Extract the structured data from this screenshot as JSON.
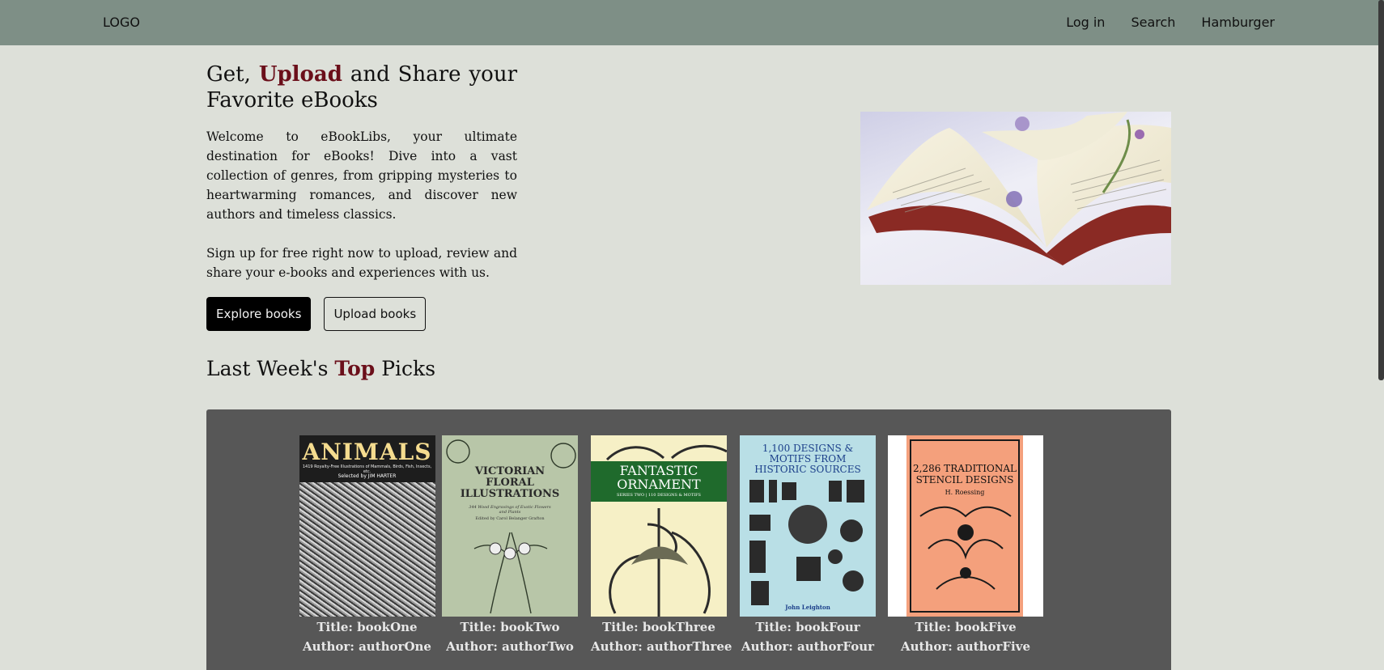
{
  "nav": {
    "logo": "LOGO",
    "links": [
      "Log in",
      "Search",
      "Hamburger"
    ]
  },
  "hero": {
    "title_prefix": "Get,",
    "title_accent": "Upload",
    "title_suffix": "and Share your Favorite eBooks",
    "paragraph1": "Welcome to eBookLibs, your ultimate destination for eBooks! Dive into a vast collection of genres, from gripping mysteries to heartwarming romances, and discover new authors and timeless classics.",
    "paragraph2": "Sign up for free right now to upload, review and share your e-books and experiences with us.",
    "explore_label": "Explore books",
    "upload_label": "Upload books"
  },
  "picks": {
    "title_prefix": "Last Week's",
    "title_accent": "Top",
    "title_suffix": "Picks",
    "books": [
      {
        "title": "Title: bookOne",
        "author": "Author: authorOne",
        "cover_text": "ANIMALS",
        "cover_sub": "1419 Royalty-Free Illustrations of Mammals, Birds, Fish, Insects, etc.",
        "cover_credit": "Selected by JIM HARTER",
        "cover_color": "#222222"
      },
      {
        "title": "Title: bookTwo",
        "author": "Author: authorTwo",
        "cover_text": "VICTORIAN FLORAL ILLUSTRATIONS",
        "cover_sub": "344 Wood Engravings of Exotic Flowers and Plants",
        "cover_credit": "Edited by Carol Belanger Grafton",
        "cover_color": "#b8c6a8"
      },
      {
        "title": "Title: bookThree",
        "author": "Author: authorThree",
        "cover_text": "FANTASTIC ORNAMENT",
        "cover_sub": "SERIES TWO | 110 DESIGNS & MOTIFS",
        "cover_credit": "",
        "cover_color": "#f6f0c6"
      },
      {
        "title": "Title: bookFour",
        "author": "Author: authorFour",
        "cover_text": "1,100 DESIGNS & MOTIFS FROM HISTORIC SOURCES",
        "cover_sub": "",
        "cover_credit": "John Leighton",
        "cover_color": "#b9dfe6"
      },
      {
        "title": "Title: bookFive",
        "author": "Author: authorFive",
        "cover_text": "2,286 TRADITIONAL STENCIL DESIGNS",
        "cover_sub": "",
        "cover_credit": "H. Roessing",
        "cover_color": "#f4a07c"
      }
    ]
  }
}
